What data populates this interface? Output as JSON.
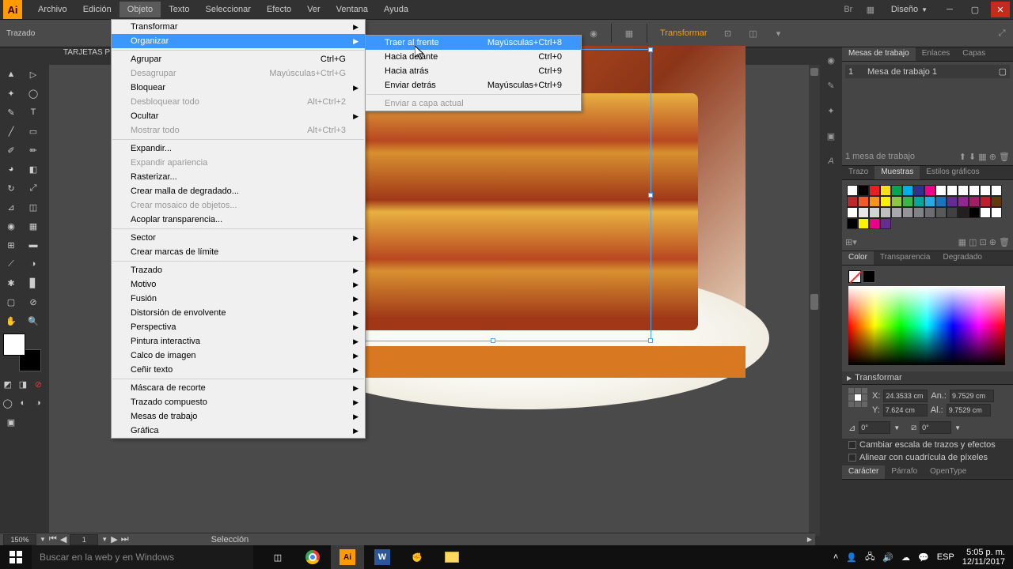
{
  "app": {
    "icon_label": "Ai"
  },
  "menubar": {
    "items": [
      "Archivo",
      "Edición",
      "Objeto",
      "Texto",
      "Seleccionar",
      "Efecto",
      "Ver",
      "Ventana",
      "Ayuda"
    ],
    "active_index": 2,
    "workspace": "Diseño"
  },
  "control": {
    "doc_label": "Trazado",
    "transform_btn": "Transformar"
  },
  "doc_tab": "TARJETAS PE...",
  "object_menu": [
    {
      "label": "Transformar",
      "sub": true
    },
    {
      "label": "Organizar",
      "sub": true,
      "hl": true
    },
    {
      "sep": true
    },
    {
      "label": "Agrupar",
      "shortcut": "Ctrl+G"
    },
    {
      "label": "Desagrupar",
      "shortcut": "Mayúsculas+Ctrl+G",
      "disabled": true
    },
    {
      "label": "Bloquear",
      "sub": true
    },
    {
      "label": "Desbloquear todo",
      "shortcut": "Alt+Ctrl+2",
      "disabled": true
    },
    {
      "label": "Ocultar",
      "sub": true
    },
    {
      "label": "Mostrar todo",
      "shortcut": "Alt+Ctrl+3",
      "disabled": true
    },
    {
      "sep": true
    },
    {
      "label": "Expandir..."
    },
    {
      "label": "Expandir apariencia",
      "disabled": true
    },
    {
      "label": "Rasterizar..."
    },
    {
      "label": "Crear malla de degradado..."
    },
    {
      "label": "Crear mosaico de objetos...",
      "disabled": true
    },
    {
      "label": "Acoplar transparencia..."
    },
    {
      "sep": true
    },
    {
      "label": "Sector",
      "sub": true
    },
    {
      "label": "Crear marcas de límite"
    },
    {
      "sep": true
    },
    {
      "label": "Trazado",
      "sub": true
    },
    {
      "label": "Motivo",
      "sub": true
    },
    {
      "label": "Fusión",
      "sub": true
    },
    {
      "label": "Distorsión de envolvente",
      "sub": true
    },
    {
      "label": "Perspectiva",
      "sub": true
    },
    {
      "label": "Pintura interactiva",
      "sub": true
    },
    {
      "label": "Calco de imagen",
      "sub": true
    },
    {
      "label": "Ceñir texto",
      "sub": true
    },
    {
      "sep": true
    },
    {
      "label": "Máscara de recorte",
      "sub": true
    },
    {
      "label": "Trazado compuesto",
      "sub": true
    },
    {
      "label": "Mesas de trabajo",
      "sub": true
    },
    {
      "label": "Gráfica",
      "sub": true
    }
  ],
  "arrange_submenu": [
    {
      "label": "Traer al frente",
      "shortcut": "Mayúsculas+Ctrl+8",
      "hl": true
    },
    {
      "label": "Hacia delante",
      "shortcut": "Ctrl+0"
    },
    {
      "label": "Hacia atrás",
      "shortcut": "Ctrl+9"
    },
    {
      "label": "Enviar detrás",
      "shortcut": "Mayúsculas+Ctrl+9"
    },
    {
      "sep": true
    },
    {
      "label": "Enviar a capa actual",
      "disabled": true
    }
  ],
  "status": {
    "zoom": "150%",
    "page": "1",
    "mode": "Selección"
  },
  "panels": {
    "artboards": {
      "tabs": [
        "Mesas de trabajo",
        "Enlaces",
        "Capas"
      ],
      "row_num": "1",
      "row_name": "Mesa de trabajo 1",
      "footer": "1 mesa de trabajo"
    },
    "swatches": {
      "tabs": [
        "Trazo",
        "Muestras",
        "Estilos gráficos"
      ],
      "active": 1
    },
    "color": {
      "tabs": [
        "Color",
        "Transparencia",
        "Degradado"
      ],
      "active": 0
    },
    "transform": {
      "title": "Transformar",
      "x_label": "X:",
      "x": "24.3533 cm",
      "y_label": "Y:",
      "y": "7.624 cm",
      "w_label": "An.:",
      "w": "9.7529 cm",
      "h_label": "Al.:",
      "h": "9.7529 cm",
      "angle1": "0°",
      "angle2": "0°",
      "chk1": "Cambiar escala de trazos y efectos",
      "chk2": "Alinear con cuadrícula de píxeles"
    },
    "type": {
      "tabs": [
        "Carácter",
        "Párrafo",
        "OpenType"
      ],
      "active": 0
    }
  },
  "swatch_colors": [
    "#ffffff",
    "#000000",
    "#ed1c24",
    "#ffde17",
    "#00a651",
    "#00aeef",
    "#2e3192",
    "#ec008c",
    "#ffffff",
    "#fff",
    "#fff",
    "#fff",
    "#fff",
    "#fff",
    "#c0272d",
    "#f15a29",
    "#f7941e",
    "#fff200",
    "#8dc63f",
    "#39b54a",
    "#00a79d",
    "#27aae1",
    "#1c75bc",
    "#662d91",
    "#92278f",
    "#9e1f63",
    "#be1e2d",
    "#603913",
    "#ffffff",
    "#e6e7e8",
    "#d1d3d4",
    "#bcbec0",
    "#a7a9ac",
    "#939598",
    "#808285",
    "#6d6e71",
    "#58595b",
    "#414042",
    "#231f20",
    "#000000",
    "#fff",
    "#fff",
    "#000",
    "#fff200",
    "#ec008c",
    "#662d91"
  ],
  "taskbar": {
    "search_placeholder": "Buscar en la web y en Windows",
    "lang": "ESP",
    "time": "5:05 p. m.",
    "date": "12/11/2017"
  }
}
